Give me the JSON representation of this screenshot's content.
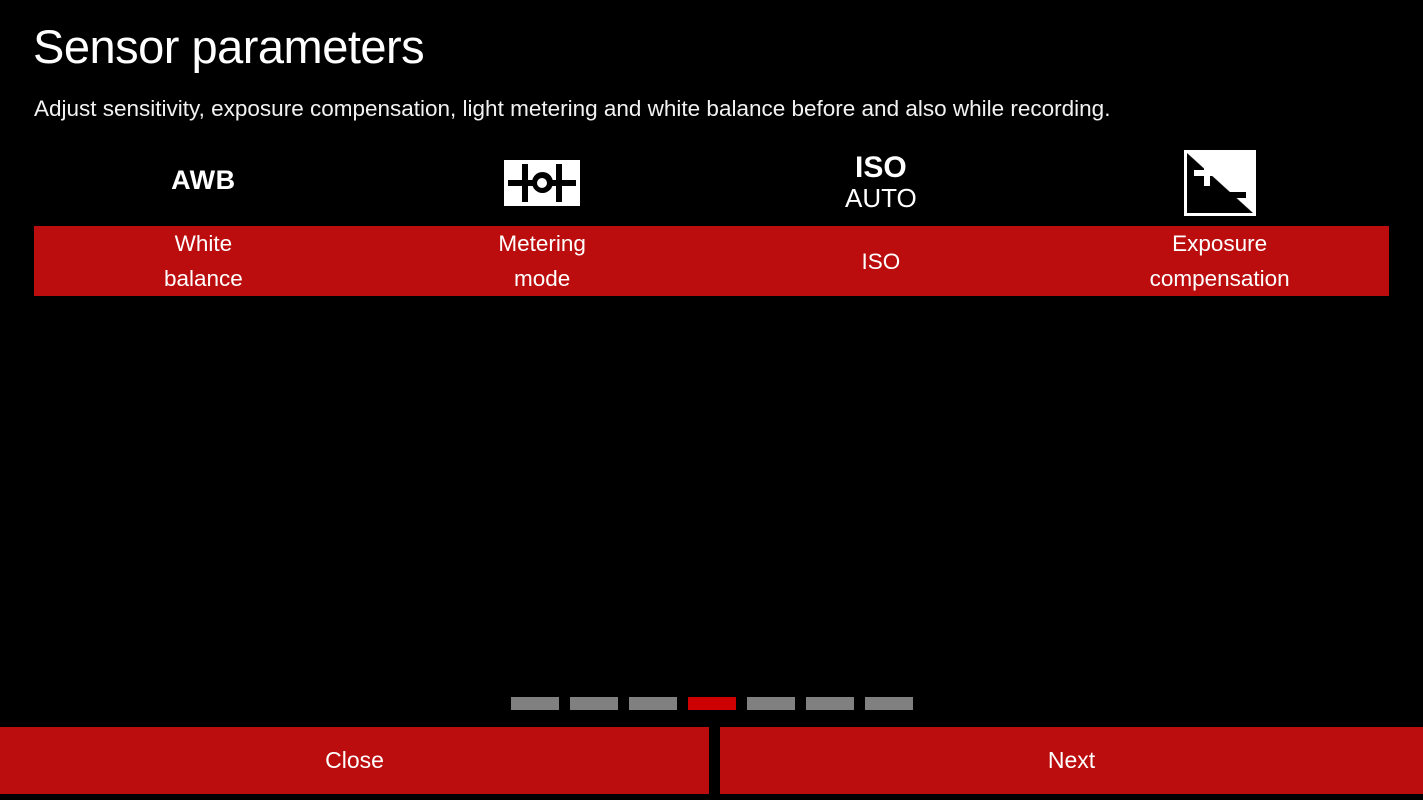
{
  "header": {
    "title": "Sensor parameters",
    "subtitle": "Adjust sensitivity, exposure compensation, light metering and white balance before and also while recording."
  },
  "colors": {
    "background": "#000000",
    "accent_red": "#bb0d0d",
    "pager_active": "#cc0000",
    "pager_inactive": "#808080",
    "text": "#ffffff"
  },
  "parameters": [
    {
      "icon_name": "awb-icon",
      "icon_text": "AWB",
      "label": "White\nbalance"
    },
    {
      "icon_name": "metering-mode-icon",
      "icon_text": "",
      "label": "Metering\nmode"
    },
    {
      "icon_name": "iso-auto-icon",
      "icon_text_top": "ISO",
      "icon_text_bottom": "AUTO",
      "label": "ISO"
    },
    {
      "icon_name": "exposure-compensation-icon",
      "icon_text": "",
      "label": "Exposure\ncompensation"
    }
  ],
  "pager": {
    "total": 7,
    "active_index": 3
  },
  "footer": {
    "close_label": "Close",
    "next_label": "Next"
  }
}
